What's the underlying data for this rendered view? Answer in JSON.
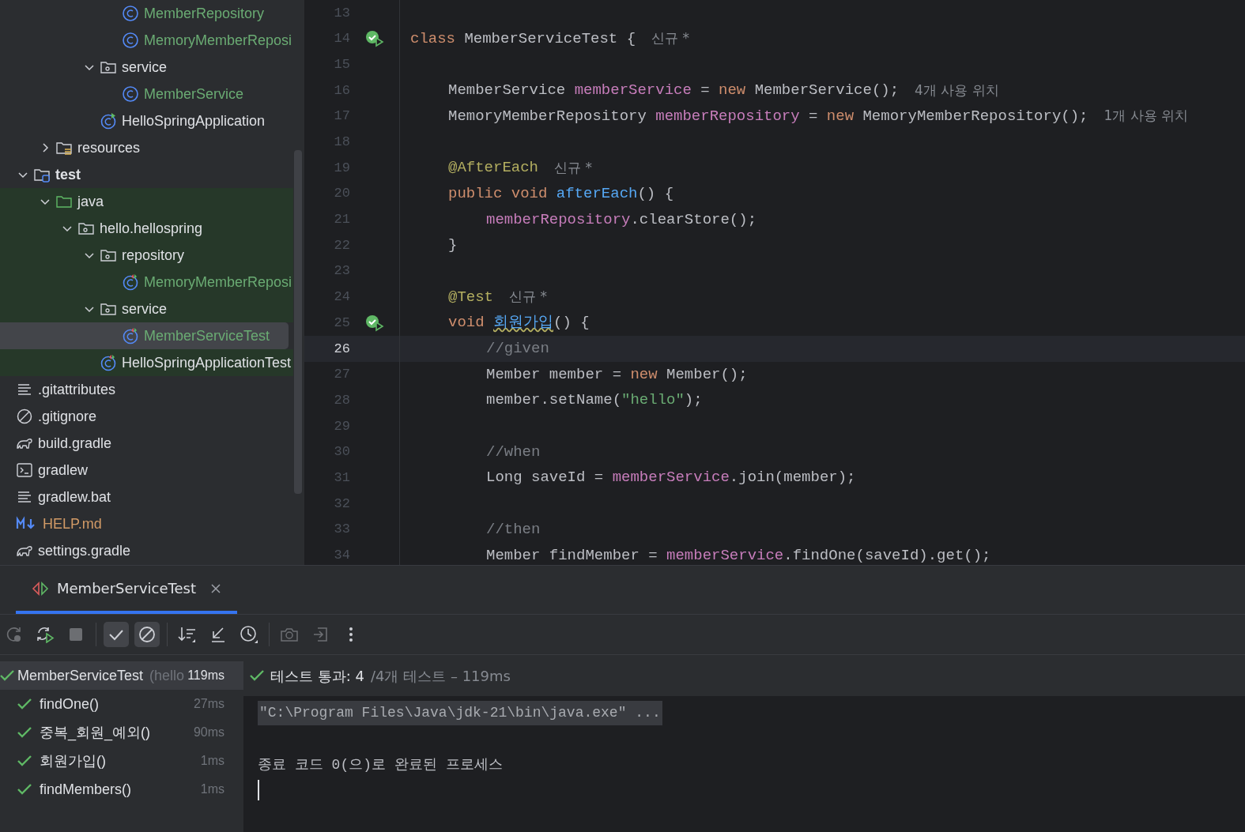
{
  "project_tree": {
    "nodes": [
      {
        "children": [
          {
            "children": [
              {
                "children": [
                  {
                    "children": [
                      {
                        "label": "MemberRepository",
                        "kind": "class",
                        "color": "#6aab73",
                        "selected": false
                      },
                      {
                        "label": "MemoryMemberReposi",
                        "kind": "class",
                        "color": "#6aab73",
                        "selected": false
                      }
                    ]
                  },
                  {
                    "label": "service",
                    "kind": "package",
                    "color": "#dfe1e5",
                    "selected": false,
                    "expanded": true,
                    "children": [
                      {
                        "label": "MemberService",
                        "kind": "class",
                        "color": "#6aab73",
                        "selected": false
                      }
                    ]
                  },
                  {
                    "label": "HelloSpringApplication",
                    "kind": "app-class",
                    "color": "#dfe1e5",
                    "selected": false
                  }
                ]
              }
            ]
          },
          {
            "label": "resources",
            "kind": "resources-folder",
            "color": "#dfe1e5",
            "selected": false,
            "expanded": false
          }
        ]
      },
      {
        "label": "test",
        "kind": "test-root",
        "color": "#dfe1e5",
        "bold": true,
        "selected": false,
        "expanded": true,
        "children": [
          {
            "label": "java",
            "kind": "test-folder",
            "color": "#dfe1e5",
            "selected": false,
            "expanded": true,
            "children": [
              {
                "label": "hello.hellospring",
                "kind": "package",
                "color": "#dfe1e5",
                "selected": false,
                "expanded": true,
                "children": [
                  {
                    "label": "repository",
                    "kind": "package",
                    "color": "#dfe1e5",
                    "selected": false,
                    "expanded": true,
                    "children": [
                      {
                        "label": "MemoryMemberReposi",
                        "kind": "test-class",
                        "color": "#6aab73",
                        "selected": false
                      }
                    ]
                  },
                  {
                    "label": "service",
                    "kind": "package",
                    "color": "#dfe1e5",
                    "selected": false,
                    "expanded": true,
                    "children": [
                      {
                        "label": "MemberServiceTest",
                        "kind": "test-class",
                        "color": "#6aab73",
                        "selected": true
                      }
                    ]
                  },
                  {
                    "label": "HelloSpringApplicationTest",
                    "kind": "test-class",
                    "color": "#dfe1e5",
                    "selected": false
                  }
                ]
              }
            ]
          }
        ]
      },
      {
        "label": ".gitattributes",
        "kind": "text-file",
        "color": "#dfe1e5",
        "selected": false
      },
      {
        "label": ".gitignore",
        "kind": "ignore-file",
        "color": "#dfe1e5",
        "selected": false
      },
      {
        "label": "build.gradle",
        "kind": "gradle-file",
        "color": "#dfe1e5",
        "selected": false
      },
      {
        "label": "gradlew",
        "kind": "shell-file",
        "color": "#dfe1e5",
        "selected": false
      },
      {
        "label": "gradlew.bat",
        "kind": "text-file",
        "color": "#dfe1e5",
        "selected": false
      },
      {
        "label": "HELP.md",
        "kind": "markdown-file",
        "color": "#d19a66",
        "selected": false
      },
      {
        "label": "settings.gradle",
        "kind": "gradle-file",
        "color": "#dfe1e5",
        "selected": false
      }
    ]
  },
  "editor": {
    "lines": [
      {
        "number": "13",
        "current": false,
        "run": false
      },
      {
        "number": "14",
        "current": false,
        "run": true,
        "tokens": [
          {
            "kind": "keyword",
            "text": "class"
          },
          {
            "kind": "plain",
            "text": "MemberServiceTest {"
          },
          {
            "kind": "hint",
            "text": "신규 *"
          }
        ],
        "children": [
          {
            "number": "15",
            "current": false,
            "run": false
          },
          {
            "number": "16",
            "current": false,
            "run": false,
            "tokens": [
              {
                "kind": "plain",
                "text": "MemberService"
              },
              {
                "kind": "field",
                "text": "memberService"
              },
              {
                "kind": "plain",
                "text": "="
              },
              {
                "kind": "keyword",
                "text": "new"
              },
              {
                "kind": "plain",
                "text": "MemberService();"
              },
              {
                "kind": "hint",
                "text": "4개 사용 위치"
              }
            ]
          },
          {
            "number": "17",
            "current": false,
            "run": false,
            "tokens": [
              {
                "kind": "plain",
                "text": "MemoryMemberRepository"
              },
              {
                "kind": "field",
                "text": "memberRepository"
              },
              {
                "kind": "plain",
                "text": "="
              },
              {
                "kind": "keyword",
                "text": "new"
              },
              {
                "kind": "plain",
                "text": "MemoryMemberRepository();"
              },
              {
                "kind": "hint",
                "text": "1개 사용 위치"
              }
            ]
          },
          {
            "number": "18",
            "current": false,
            "run": false
          },
          {
            "number": "19",
            "current": false,
            "run": false,
            "tokens": [
              {
                "kind": "annotation",
                "text": "@AfterEach"
              },
              {
                "kind": "hint",
                "text": "신규 *"
              }
            ]
          },
          {
            "number": "20",
            "current": false,
            "run": false,
            "tokens": [
              {
                "kind": "keyword",
                "text": "public void"
              },
              {
                "kind": "method",
                "text": "afterEach"
              },
              {
                "kind": "plain",
                "text": "() {",
                "join": true
              }
            ],
            "children": [
              {
                "number": "21",
                "current": false,
                "run": false,
                "tokens": [
                  {
                    "kind": "field",
                    "text": "memberRepository"
                  },
                  {
                    "kind": "plain",
                    "text": ".clearStore();",
                    "join": true
                  }
                ]
              }
            ]
          },
          {
            "number": "22",
            "current": false,
            "run": false,
            "tokens": [
              {
                "kind": "plain",
                "text": "}"
              }
            ]
          },
          {
            "number": "23",
            "current": false,
            "run": false
          },
          {
            "number": "24",
            "current": false,
            "run": false,
            "tokens": [
              {
                "kind": "annotation",
                "text": "@Test"
              },
              {
                "kind": "hint",
                "text": "신규 *"
              }
            ]
          },
          {
            "number": "25",
            "current": false,
            "run": true,
            "tokens": [
              {
                "kind": "keyword",
                "text": "void"
              },
              {
                "kind": "method",
                "text": "회원가입",
                "warning": true
              },
              {
                "kind": "plain",
                "text": "() {",
                "join": true
              }
            ],
            "children": [
              {
                "number": "26",
                "current": true,
                "run": false,
                "tokens": [
                  {
                    "kind": "comment",
                    "text": "//given"
                  }
                ]
              },
              {
                "number": "27",
                "current": false,
                "run": false,
                "tokens": [
                  {
                    "kind": "plain",
                    "text": "Member member ="
                  },
                  {
                    "kind": "keyword",
                    "text": "new"
                  },
                  {
                    "kind": "plain",
                    "text": "Member();"
                  }
                ]
              },
              {
                "number": "28",
                "current": false,
                "run": false,
                "tokens": [
                  {
                    "kind": "plain",
                    "text": "member.setName("
                  },
                  {
                    "kind": "string",
                    "text": "\"hello\"",
                    "join": true
                  },
                  {
                    "kind": "plain",
                    "text": ");",
                    "join": true
                  }
                ]
              },
              {
                "number": "29",
                "current": false,
                "run": false
              },
              {
                "number": "30",
                "current": false,
                "run": false,
                "tokens": [
                  {
                    "kind": "comment",
                    "text": "//when"
                  }
                ]
              },
              {
                "number": "31",
                "current": false,
                "run": false,
                "tokens": [
                  {
                    "kind": "plain",
                    "text": "Long saveId ="
                  },
                  {
                    "kind": "field",
                    "text": "memberService"
                  },
                  {
                    "kind": "plain",
                    "text": ".join(member);",
                    "join": true
                  }
                ]
              },
              {
                "number": "32",
                "current": false,
                "run": false
              },
              {
                "number": "33",
                "current": false,
                "run": false,
                "tokens": [
                  {
                    "kind": "comment",
                    "text": "//then"
                  }
                ]
              },
              {
                "number": "34",
                "current": false,
                "run": false,
                "tokens": [
                  {
                    "kind": "plain",
                    "text": "Member findMember ="
                  },
                  {
                    "kind": "field",
                    "text": "memberService"
                  },
                  {
                    "kind": "plain",
                    "text": ".findOne(saveId).get();",
                    "join": true
                  }
                ]
              }
            ]
          }
        ]
      }
    ]
  },
  "run_panel": {
    "tabs": [
      {
        "label": "MemberServiceTest",
        "selected": true
      }
    ],
    "toolbar": [
      {
        "kind": "rerun",
        "disabled": true
      },
      {
        "kind": "rerun-failed",
        "disabled": false
      },
      {
        "kind": "stop",
        "disabled": true
      },
      {
        "kind": "separator"
      },
      {
        "kind": "show-passed",
        "disabled": false,
        "selected": true
      },
      {
        "kind": "show-ignored",
        "disabled": false,
        "selected": true
      },
      {
        "kind": "separator"
      },
      {
        "kind": "sort",
        "disabled": false
      },
      {
        "kind": "collapse",
        "disabled": false
      },
      {
        "kind": "history",
        "disabled": false
      },
      {
        "kind": "separator"
      },
      {
        "kind": "screenshot",
        "disabled": true
      },
      {
        "kind": "export",
        "disabled": true
      },
      {
        "kind": "more",
        "disabled": false
      }
    ],
    "tests": {
      "root": {
        "name": "MemberServiceTest",
        "location": "(hello",
        "time": "119ms",
        "passed": true,
        "selected": true
      },
      "children": [
        {
          "name": "findOne()",
          "time": "27ms",
          "passed": true,
          "selected": false
        },
        {
          "name": "중복_회원_예외()",
          "time": "90ms",
          "passed": true,
          "selected": false
        },
        {
          "name": "회원가입()",
          "time": "1ms",
          "passed": true,
          "selected": false
        },
        {
          "name": "findMembers()",
          "time": "1ms",
          "passed": true,
          "selected": false
        }
      ]
    },
    "summary": {
      "passed": true,
      "main": "테스트 통과: 4",
      "detail": "/4개 테스트 – 119ms"
    },
    "console": [
      {
        "kind": "command",
        "text": "\"C:\\Program Files\\Java\\jdk-21\\bin\\java.exe\" ..."
      },
      {
        "kind": "blank"
      },
      {
        "kind": "output",
        "text": "종료 코드 0(으)로 완료된 프로세스"
      },
      {
        "kind": "cursor"
      }
    ]
  }
}
